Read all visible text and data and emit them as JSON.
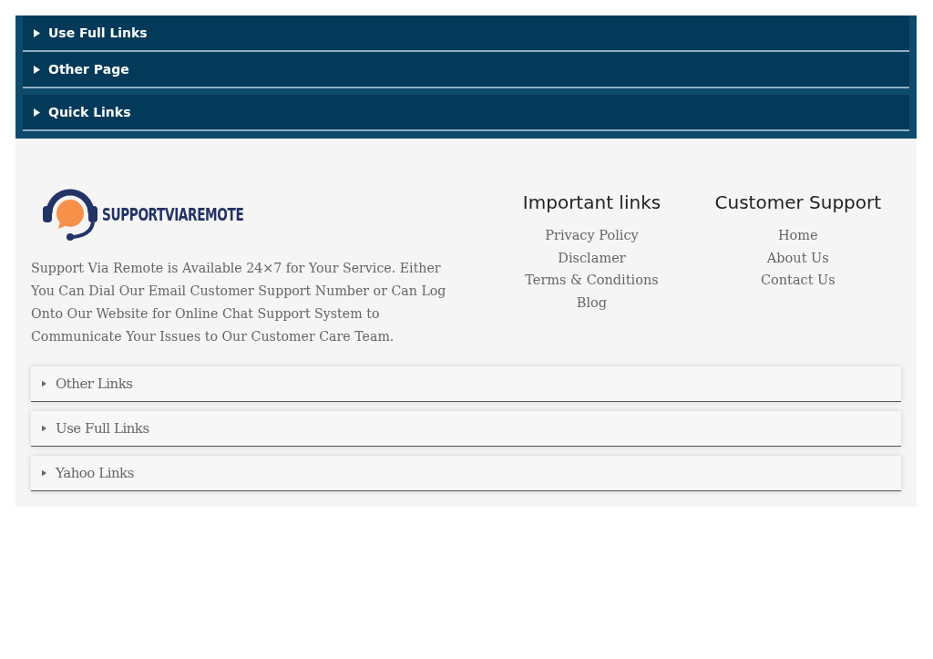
{
  "top_accordions": [
    {
      "label": "Use Full Links",
      "expanded": false
    },
    {
      "label": "Other Page",
      "expanded": false
    },
    {
      "label": "Quick Links",
      "expanded": false
    }
  ],
  "footer": {
    "logo_text": "SUPPORTVIAREMOTE",
    "about": "Support Via Remote is Available 24×7 for Your Service. Either You Can Dial Our Email Customer Support Number or Can Log Onto Our Website for Online Chat Support System to Communicate Your Issues to Our Customer Care Team.",
    "columns": [
      {
        "heading": "Important links",
        "links": [
          "Privacy Policy",
          "Disclamer",
          "Terms & Conditions",
          "Blog"
        ]
      },
      {
        "heading": "Customer Support",
        "links": [
          "Home",
          "About Us",
          "Contact Us"
        ]
      }
    ]
  },
  "bottom_accordions": [
    {
      "label": "Other Links",
      "expanded": false
    },
    {
      "label": "Use Full Links",
      "expanded": false
    },
    {
      "label": "Yahoo Links",
      "expanded": false
    }
  ]
}
